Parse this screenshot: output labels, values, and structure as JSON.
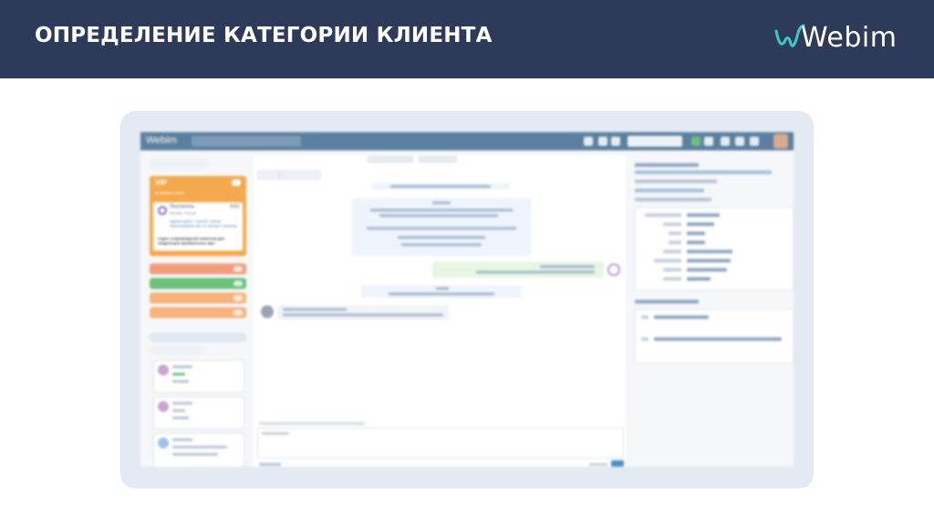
{
  "header": {
    "title": "ОПРЕДЕЛЕНИЕ КАТЕГОРИИ КЛИЕНТА",
    "logo_text": "Webim",
    "background": "#2d3a5a",
    "logo_accent": "#3ec8c8"
  },
  "screenshot": {
    "left_panel": {
      "vip_label": "VIP",
      "visitor_title": "Посетитель",
      "visitor_location": "Москва, Россия",
      "visitor_time": "9:53",
      "visitor_message": "Здравствуйте, Сергей! Сейчас перенаправлю вас на нужную страницу",
      "visitor_department": "Отдел сопровождения клиентов для владельцев премиальных карт",
      "pill_colors": [
        "#f39c7b",
        "#6cc07a",
        "#f7b37a",
        "#f7b37a"
      ]
    },
    "colors": {
      "app_header": "#5a7fa0",
      "vip": "#f4a94e",
      "send_button": "#4a90c8"
    }
  }
}
